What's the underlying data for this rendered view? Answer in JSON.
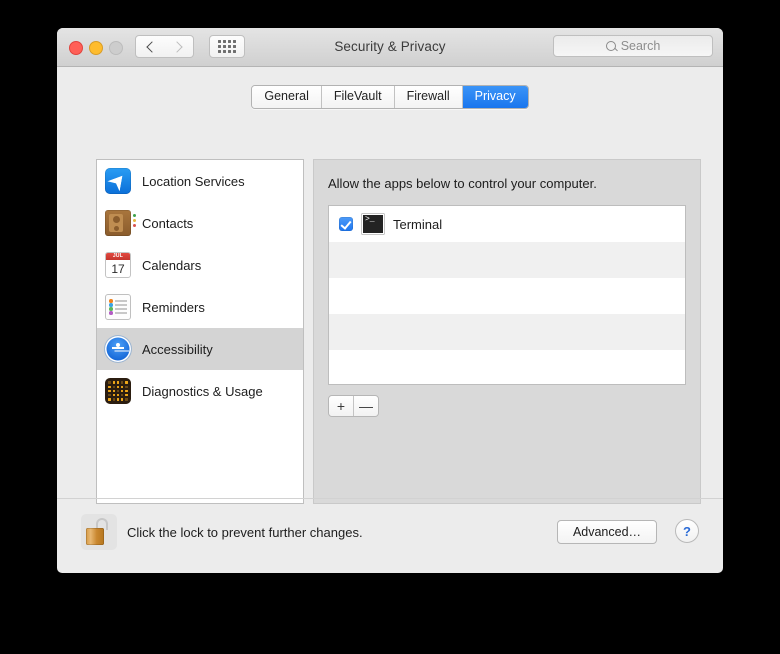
{
  "window": {
    "title": "Security & Privacy",
    "traffic_lights": [
      {
        "name": "close",
        "color": "#ff5f57"
      },
      {
        "name": "minimize",
        "color": "#febc2e"
      },
      {
        "name": "zoom",
        "color": "#cdcdcd"
      }
    ],
    "nav": {
      "back_icon": "chevron-left-icon",
      "forward_icon": "chevron-right-icon"
    },
    "show_all_icon": "grid-dots-icon"
  },
  "search": {
    "placeholder": "Search",
    "icon": "search-icon",
    "value": ""
  },
  "tabs": [
    {
      "label": "General",
      "selected": false
    },
    {
      "label": "FileVault",
      "selected": false
    },
    {
      "label": "Firewall",
      "selected": false
    },
    {
      "label": "Privacy",
      "selected": true
    }
  ],
  "accent_color": "#1d76f0",
  "sidebar": {
    "items": [
      {
        "label": "Location Services",
        "icon": "location-arrow-icon",
        "selected": false
      },
      {
        "label": "Contacts",
        "icon": "contacts-book-icon",
        "selected": false
      },
      {
        "label": "Calendars",
        "icon": "calendar-icon",
        "selected": false,
        "calendar_month": "JUL",
        "calendar_day": "17"
      },
      {
        "label": "Reminders",
        "icon": "reminders-list-icon",
        "selected": false
      },
      {
        "label": "Accessibility",
        "icon": "accessibility-person-icon",
        "selected": true
      },
      {
        "label": "Diagnostics & Usage",
        "icon": "diagnostics-dots-icon",
        "selected": false
      }
    ]
  },
  "panel": {
    "description": "Allow the apps below to control your computer.",
    "apps": [
      {
        "name": "Terminal",
        "checked": true,
        "icon": "terminal-icon",
        "icon_glyph": ">_"
      }
    ],
    "empty_row_count": 4,
    "add_button": "+",
    "remove_button": "—"
  },
  "footer": {
    "lock_icon": "unlocked-padlock-icon",
    "lock_text": "Click the lock to prevent further changes.",
    "advanced_label": "Advanced…",
    "help_label": "?"
  }
}
